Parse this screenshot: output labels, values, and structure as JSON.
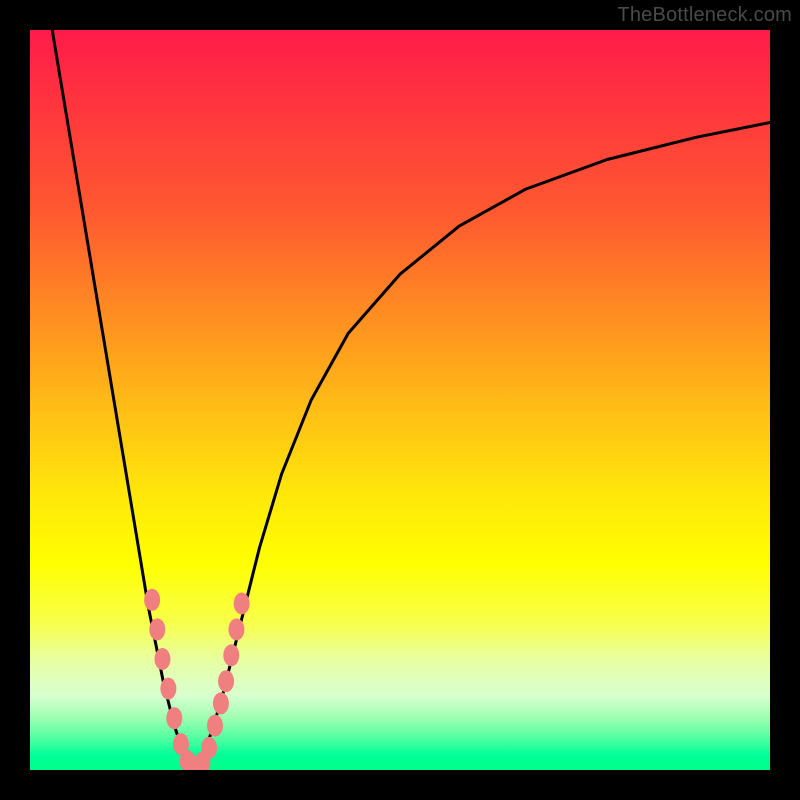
{
  "watermark": "TheBottleneck.com",
  "chart_data": {
    "type": "line",
    "title": "",
    "xlabel": "",
    "ylabel": "",
    "xlim": [
      0,
      100
    ],
    "ylim": [
      0,
      100
    ],
    "grid": false,
    "legend": false,
    "note": "Bottleneck-style V-curve. Values estimated from pixel positions; axes are unlabeled.",
    "series": [
      {
        "name": "left-branch",
        "x": [
          3,
          5,
          8,
          10,
          12,
          14,
          16,
          18,
          19.5,
          21,
          22
        ],
        "y": [
          100,
          88,
          70,
          58,
          46,
          34,
          22,
          12,
          6,
          1.5,
          0
        ]
      },
      {
        "name": "right-branch",
        "x": [
          22,
          23,
          24.5,
          26,
          27.5,
          29,
          31,
          34,
          38,
          43,
          50,
          58,
          67,
          78,
          90,
          100
        ],
        "y": [
          0,
          1.5,
          5,
          10,
          16,
          22,
          30,
          40,
          50,
          59,
          67,
          73.5,
          78.5,
          82.5,
          85.5,
          87.5
        ]
      }
    ],
    "markers": {
      "name": "salmon-beads",
      "color": "#f08080",
      "points": [
        {
          "x": 16.5,
          "y": 23
        },
        {
          "x": 17.2,
          "y": 19
        },
        {
          "x": 17.9,
          "y": 15
        },
        {
          "x": 18.7,
          "y": 11
        },
        {
          "x": 19.5,
          "y": 7
        },
        {
          "x": 20.4,
          "y": 3.5
        },
        {
          "x": 21.3,
          "y": 1.2
        },
        {
          "x": 22.3,
          "y": 0.3
        },
        {
          "x": 23.3,
          "y": 1
        },
        {
          "x": 24.2,
          "y": 3
        },
        {
          "x": 25.0,
          "y": 6
        },
        {
          "x": 25.8,
          "y": 9
        },
        {
          "x": 26.5,
          "y": 12
        },
        {
          "x": 27.2,
          "y": 15.5
        },
        {
          "x": 27.9,
          "y": 19
        },
        {
          "x": 28.6,
          "y": 22.5
        }
      ]
    }
  }
}
